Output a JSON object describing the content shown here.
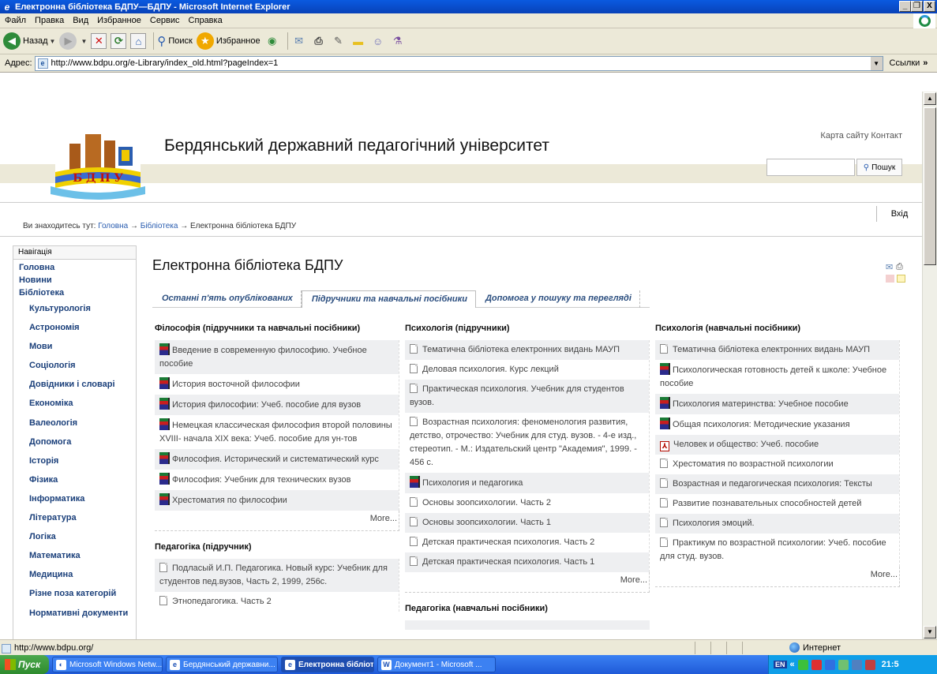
{
  "window": {
    "title": "Електронна бібліотека БДПУ—БДПУ - Microsoft Internet Explorer",
    "minimize": "_",
    "maximize": "❐",
    "close": "X"
  },
  "menu": [
    "Файл",
    "Правка",
    "Вид",
    "Избранное",
    "Сервис",
    "Справка"
  ],
  "toolbar": {
    "back_label": "Назад",
    "search_label": "Поиск",
    "favorites_label": "Избранное"
  },
  "address": {
    "label": "Адрес:",
    "url": "http://www.bdpu.org/e-Library/index_old.html?pageIndex=1",
    "links_label": "Ссылки"
  },
  "site": {
    "title": "Бердянський державний педагогічний університет",
    "logo_text": "Б Д П У",
    "top_links": "Карта сайту Контакт",
    "search_button": "Пошук",
    "login": "Вхід",
    "breadcrumb_prefix": "Ви знаходитесь тут:",
    "breadcrumb": [
      "Головна",
      "Бібліотека",
      "Електронна бібліотека БДПУ"
    ],
    "arrow": "→"
  },
  "nav": {
    "title": "Навігація",
    "top_items": [
      "Головна",
      "Новини",
      "Бібліотека"
    ],
    "sub_items": [
      "Культурологія",
      "Астрономія",
      "Мови",
      "Соціологія",
      "Довідники і словарі",
      "Економіка",
      "Валеологія",
      "Допомога",
      "Історія",
      "Фізика",
      "Інформатика",
      "Література",
      "Логіка",
      "Математика",
      "Медицина",
      "Різне поза категорій",
      "Нормативні документи"
    ]
  },
  "main": {
    "title": "Електронна бібліотека БДПУ",
    "tabs": [
      "Останні п'ять опублікованих",
      "Підручники та навчальні посібники",
      "Допомога у пошуку та перегляді"
    ],
    "more": "More..."
  },
  "columns": {
    "philosophy": {
      "heading": "Філософія (підручники та навчальні посібники)",
      "items": [
        {
          "icon": "book",
          "text": "Введение в современную философию. Учебное пособие"
        },
        {
          "icon": "book",
          "text": "История восточной философии"
        },
        {
          "icon": "book",
          "text": "История философии: Учеб. пособие для вузов"
        },
        {
          "icon": "book",
          "text": "Немецкая классическая философия второй половины XVIII- начала XIX века: Учеб. пособие для ун-тов"
        },
        {
          "icon": "book",
          "text": "Философия. Исторический и систематический курс"
        },
        {
          "icon": "book",
          "text": "Философия: Учебник для технических вузов"
        },
        {
          "icon": "book",
          "text": "Хрестоматия по философии"
        }
      ]
    },
    "pedagogy": {
      "heading": "Педагогіка (підручник)",
      "items": [
        {
          "icon": "doc",
          "text": "Подласый И.П. Педагогика. Новый курс: Учебник для студентов пед.вузов, Часть 2, 1999, 256с."
        },
        {
          "icon": "doc",
          "text": "Этнопедагогика. Часть 2"
        }
      ]
    },
    "psychology_textbooks": {
      "heading": "Психологія (підручники)",
      "items": [
        {
          "icon": "doc",
          "text": "Тематична бібліотека електронних видань МАУП"
        },
        {
          "icon": "doc",
          "text": "Деловая психология. Курс лекций"
        },
        {
          "icon": "doc",
          "text": "Практическая психология. Учебник для студентов вузов."
        },
        {
          "icon": "doc",
          "text": "Возрастная психология: феноменология развития, детство, отрочество: Учебник для студ. вузов. - 4-е изд., стереотип. - М.: Издательский центр \"Академия\", 1999. - 456 с."
        },
        {
          "icon": "book",
          "text": "Психология и педагогика"
        },
        {
          "icon": "doc",
          "text": "Основы зоопсихологии. Часть 2"
        },
        {
          "icon": "doc",
          "text": "Основы зоопсихологии. Часть 1"
        },
        {
          "icon": "doc",
          "text": "Детская практическая психология. Часть 2"
        },
        {
          "icon": "doc",
          "text": "Детская практическая психология. Часть 1"
        }
      ]
    },
    "pedagogy_manuals": {
      "heading": "Педагогіка (навчальні посібники)"
    },
    "psychology_manuals": {
      "heading": "Психологія (навчальні посібники)",
      "items": [
        {
          "icon": "doc",
          "text": "Тематична бібліотека електронних видань МАУП"
        },
        {
          "icon": "book",
          "text": "Психологическая готовность детей к школе: Учебное пособие"
        },
        {
          "icon": "book",
          "text": "Психология материнства: Учебное пособие"
        },
        {
          "icon": "book",
          "text": "Общая психология: Методические указания"
        },
        {
          "icon": "pdf",
          "text": "Человек и общество: Учеб. пособие"
        },
        {
          "icon": "doc",
          "text": "Хрестоматия по возрастной психологии"
        },
        {
          "icon": "doc",
          "text": "Возрастная и педагогическая психология: Тексты"
        },
        {
          "icon": "doc",
          "text": "Развитие познавательных способностей детей"
        },
        {
          "icon": "doc",
          "text": "Психология эмоций."
        },
        {
          "icon": "doc",
          "text": "Практикум по возрастной психологии: Учеб. пособие для студ. вузов."
        }
      ]
    }
  },
  "status": {
    "url": "http://www.bdpu.org/",
    "zone": "Интернет"
  },
  "taskbar": {
    "start": "Пуск",
    "tasks": [
      {
        "label": "Microsoft Windows Netw...",
        "active": false
      },
      {
        "label": "Бердянський державни...",
        "active": false
      },
      {
        "label": "Електронна бібліоте...",
        "active": true
      },
      {
        "label": "Документ1 - Microsoft ...",
        "active": false
      }
    ],
    "lang": "EN",
    "clock": "21:5"
  },
  "colors": {
    "titlebar": "#0a5ae0",
    "nav_link": "#1a3f7a",
    "tab_text": "#2b4e7f",
    "taskbar": "#2a6ae8"
  }
}
